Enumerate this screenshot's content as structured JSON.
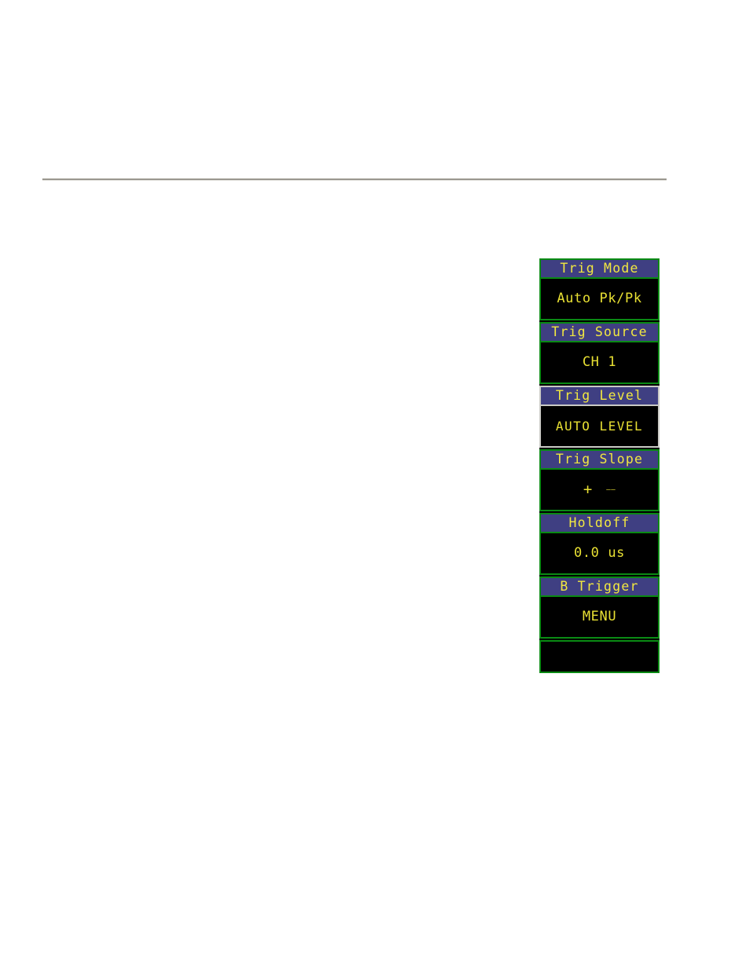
{
  "page": {
    "background_color": "#ffffff",
    "rule_color": "#8a8880"
  },
  "scope_menu": {
    "panel_name": "trigger-menu",
    "colors": {
      "border_normal": "#0a8a14",
      "border_selected": "#c9c9c4",
      "header_background": "#3f3f82",
      "header_text": "#f2e840",
      "value_text": "#e8e033",
      "screen_background": "#000000"
    },
    "sections": [
      {
        "id": "trig-mode",
        "header": "Trig Mode",
        "value": "Auto Pk/Pk",
        "selected": false,
        "kind": "text"
      },
      {
        "id": "trig-source",
        "header": "Trig Source",
        "value": "CH 1",
        "selected": false,
        "kind": "text"
      },
      {
        "id": "trig-level",
        "header": "Trig Level",
        "value": "AUTO LEVEL",
        "selected": true,
        "kind": "text"
      },
      {
        "id": "trig-slope",
        "header": "Trig Slope",
        "value": "+",
        "value_secondary": "––",
        "selected": false,
        "kind": "slope"
      },
      {
        "id": "holdoff",
        "header": "Holdoff",
        "value": "0.0 us",
        "selected": false,
        "kind": "text"
      },
      {
        "id": "b-trigger",
        "header": "B Trigger",
        "value": "MENU",
        "selected": false,
        "kind": "text"
      },
      {
        "id": "blank",
        "header": "",
        "value": "",
        "selected": false,
        "kind": "empty"
      }
    ]
  }
}
